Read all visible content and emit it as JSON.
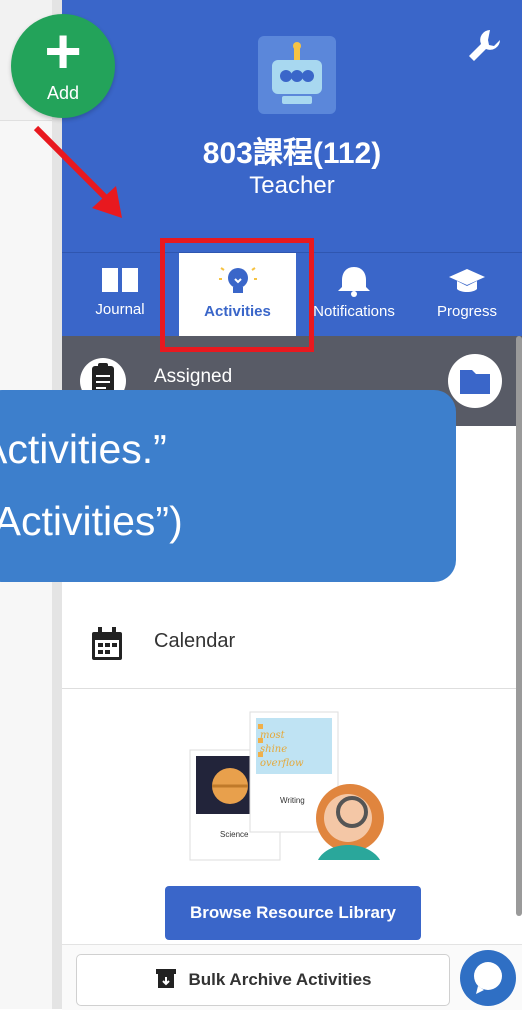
{
  "add_button": {
    "label": "Add"
  },
  "header": {
    "class_name": "803課程(112)",
    "role": "Teacher"
  },
  "tabs": [
    {
      "label": "Journal",
      "icon": "book-icon",
      "active": false
    },
    {
      "label": "Activities",
      "icon": "lightbulb-icon",
      "active": true
    },
    {
      "label": "Notifications",
      "icon": "bell-icon",
      "active": false
    },
    {
      "label": "Progress",
      "icon": "graduation-cap-icon",
      "active": false
    }
  ],
  "assigned": {
    "label": "Assigned"
  },
  "calendar": {
    "label": "Calendar"
  },
  "callout": {
    "line1": "Activities.”",
    "line2": "“Activities”)"
  },
  "illustration": {
    "card1": "Science",
    "card2": "Writing",
    "note_lines": [
      "most",
      "shine",
      "overflow"
    ]
  },
  "buttons": {
    "browse": "Browse Resource Library",
    "archive": "Bulk Archive Activities"
  },
  "colors": {
    "header_blue": "#3a66c9",
    "add_green": "#23a35a",
    "highlight_red": "#e8191f",
    "callout_blue": "#3d7fcc"
  }
}
